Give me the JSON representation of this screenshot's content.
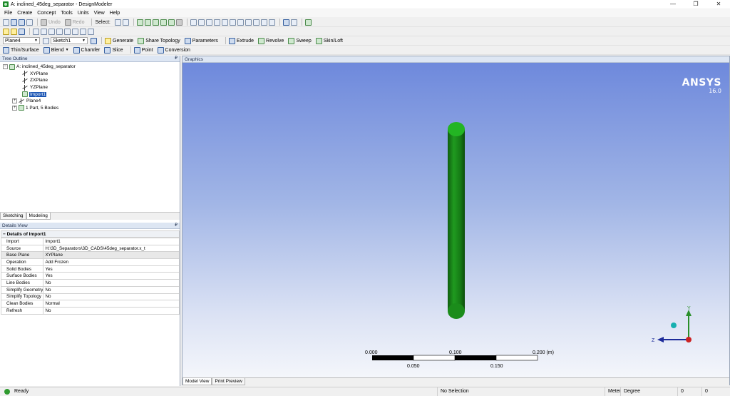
{
  "window": {
    "title": "A: inclined_45deg_separator - DesignModeler",
    "controls": [
      "—",
      "❐",
      "✕"
    ]
  },
  "menu": [
    "File",
    "Create",
    "Concept",
    "Tools",
    "Units",
    "View",
    "Help"
  ],
  "toolbar1": {
    "undo_label": "Undo",
    "redo_label": "Redo",
    "select_label": "Select:"
  },
  "toolbar3": {
    "plane_combo": "Plane4",
    "sketch_combo": "Sketch1",
    "generate": "Generate",
    "share_topology": "Share Topology",
    "parameters": "Parameters",
    "extrude": "Extrude",
    "revolve": "Revolve",
    "sweep": "Sweep",
    "skin_loft": "Skin/Loft"
  },
  "toolbar4": {
    "thin_surface": "Thin/Surface",
    "blend": "Blend",
    "chamfer": "Chamfer",
    "slice": "Slice",
    "point": "Point",
    "conversion": "Conversion"
  },
  "tree_outline": {
    "title": "Tree Outline",
    "pin": "₽",
    "root": "A: inclined_45deg_separator",
    "items": [
      {
        "label": "XYPlane"
      },
      {
        "label": "ZXPlane"
      },
      {
        "label": "YZPlane"
      },
      {
        "label": "Import1"
      },
      {
        "label": "Plane4"
      },
      {
        "label": "1 Part, 5 Bodies"
      }
    ]
  },
  "mode_tabs": [
    "Sketching",
    "Modeling"
  ],
  "details_view": {
    "title": "Details View",
    "pin": "₽",
    "header": "Details of Import1",
    "rows": [
      {
        "name": "Import",
        "value": "Import1"
      },
      {
        "name": "Source",
        "value": "H:\\3D_Separators\\3D_CADS\\45deg_separator.x_t"
      },
      {
        "name": "Base Plane",
        "value": "XYPlane"
      },
      {
        "name": "Operation",
        "value": "Add Frozen"
      },
      {
        "name": "Solid Bodies",
        "value": "Yes"
      },
      {
        "name": "Surface Bodies",
        "value": "Yes"
      },
      {
        "name": "Line Bodies",
        "value": "No"
      },
      {
        "name": "Simplify Geometry",
        "value": "No"
      },
      {
        "name": "Simplify Topology",
        "value": "No"
      },
      {
        "name": "Clean Bodies",
        "value": "Normal"
      },
      {
        "name": "Refresh",
        "value": "No"
      }
    ]
  },
  "graphics": {
    "title": "Graphics",
    "brand": "ANSYS",
    "version": "16.0",
    "scale_labels_top": [
      "0.000",
      "0.100",
      "0.200 (m)"
    ],
    "scale_labels_bottom": [
      "0.050",
      "0.150"
    ],
    "axis_labels": {
      "y": "Y",
      "z": "Z"
    },
    "colors": {
      "body": "#1f8c1f",
      "axis_y": "#2a8f2a",
      "axis_z": "#1d2b9a",
      "axis_x": "#cc2222"
    }
  },
  "view_tabs": [
    "Model View",
    "Print Preview"
  ],
  "status": {
    "ready": "Ready",
    "selection": "No Selection",
    "unit_length": "Meter",
    "unit_angle": "Degree",
    "value1": "0",
    "value2": "0"
  }
}
